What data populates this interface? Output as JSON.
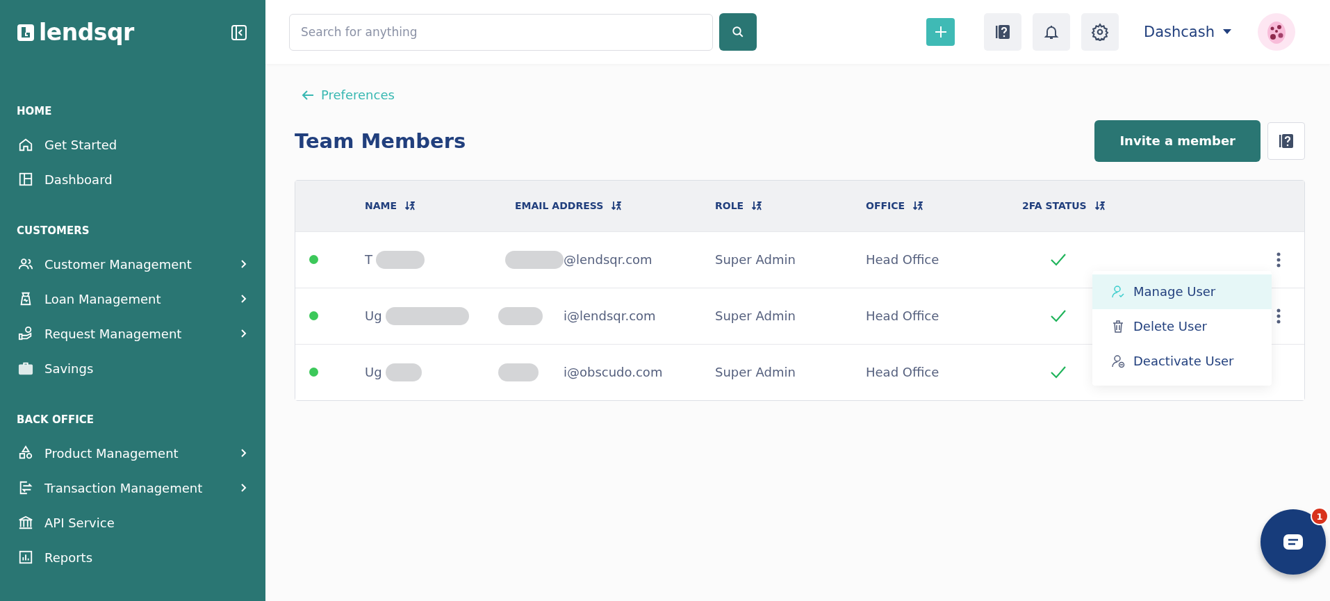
{
  "sidebar": {
    "logo": "lendsqr",
    "sections": [
      {
        "heading": "HOME",
        "items": [
          {
            "label": "Get Started",
            "expandable": false
          },
          {
            "label": "Dashboard",
            "expandable": false
          }
        ]
      },
      {
        "heading": "CUSTOMERS",
        "items": [
          {
            "label": "Customer Management",
            "expandable": true
          },
          {
            "label": "Loan Management",
            "expandable": true
          },
          {
            "label": "Request Management",
            "expandable": true
          },
          {
            "label": "Savings",
            "expandable": false
          }
        ]
      },
      {
        "heading": "BACK OFFICE",
        "items": [
          {
            "label": "Product Management",
            "expandable": true
          },
          {
            "label": "Transaction Management",
            "expandable": true
          },
          {
            "label": "API Service",
            "expandable": false
          },
          {
            "label": "Reports",
            "expandable": false
          }
        ]
      }
    ]
  },
  "topbar": {
    "search": {
      "placeholder": "Search for anything"
    },
    "account": "Dashcash"
  },
  "page": {
    "back_link": "Preferences",
    "title": "Team Members",
    "invite_button": "Invite a member"
  },
  "table": {
    "columns": [
      {
        "label": "NAME"
      },
      {
        "label": "EMAIL ADDRESS"
      },
      {
        "label": "ROLE"
      },
      {
        "label": "OFFICE"
      },
      {
        "label": "2FA STATUS"
      }
    ],
    "rows": [
      {
        "color": "#3cc85a",
        "name": "T",
        "email": "@lendsqr.com",
        "role": "Super Admin",
        "office": "Head Office",
        "twofa": true,
        "more_button": true
      },
      {
        "color": "#3cc85a",
        "name": "Ug",
        "email": "i@lendsqr.com",
        "role": "Super Admin",
        "office": "Head Office",
        "twofa": true,
        "more_button": true
      },
      {
        "color": "#3cc85a",
        "name": "Ug",
        "email": "i@obscudo.com",
        "role": "Super Admin",
        "office": "Head Office",
        "twofa": true,
        "more_button": false
      }
    ]
  },
  "row_menu": {
    "items": [
      {
        "label": "Manage User",
        "selected": true
      },
      {
        "label": "Delete User",
        "selected": false
      },
      {
        "label": "Deactivate User",
        "selected": false
      }
    ]
  },
  "chat": {
    "badge": "1"
  }
}
